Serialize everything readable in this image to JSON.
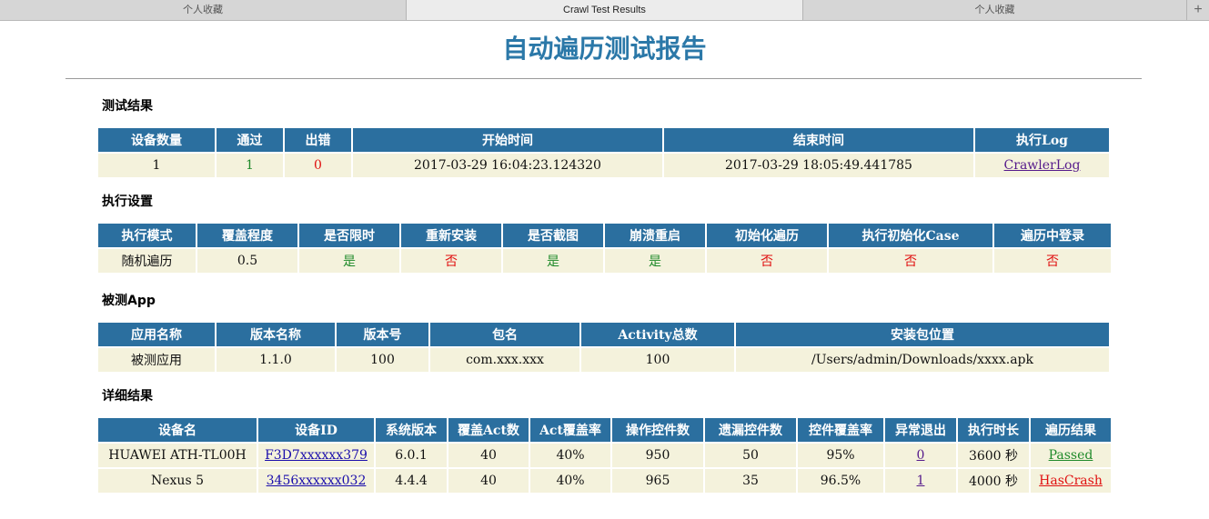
{
  "tabs": [
    "个人收藏",
    "Crawl Test Results",
    "个人收藏"
  ],
  "tab_plus": "+",
  "title": "自动遍历测试报告",
  "section1": {
    "label": "测试结果",
    "headers": [
      "设备数量",
      "通过",
      "出错",
      "开始时间",
      "结束时间",
      "执行Log"
    ],
    "row": {
      "count": "1",
      "pass": "1",
      "fail": "0",
      "start": "2017-03-29 16:04:23.124320",
      "end": "2017-03-29 18:05:49.441785",
      "log": "CrawlerLog"
    }
  },
  "section2": {
    "label": "执行设置",
    "headers": [
      "执行模式",
      "覆盖程度",
      "是否限时",
      "重新安装",
      "是否截图",
      "崩溃重启",
      "初始化遍历",
      "执行初始化Case",
      "遍历中登录"
    ],
    "row": {
      "mode": "随机遍历",
      "coverage": "0.5",
      "time_limit": "是",
      "reinstall": "否",
      "screenshot": "是",
      "crash_restart": "是",
      "init_crawl": "否",
      "init_case": "否",
      "login": "否"
    }
  },
  "section3": {
    "label": "被测App",
    "headers": [
      "应用名称",
      "版本名称",
      "版本号",
      "包名",
      "Activity总数",
      "安装包位置"
    ],
    "row": {
      "app_name": "被测应用",
      "version_name": "1.1.0",
      "version_code": "100",
      "package": "com.xxx.xxx",
      "activities": "100",
      "apk_path": "/Users/admin/Downloads/xxxx.apk"
    }
  },
  "section4": {
    "label": "详细结果",
    "headers": [
      "设备名",
      "设备ID",
      "系统版本",
      "覆盖Act数",
      "Act覆盖率",
      "操作控件数",
      "遗漏控件数",
      "控件覆盖率",
      "异常退出",
      "执行时长",
      "遍历结果"
    ],
    "rows": [
      {
        "device": "HUAWEI ATH-TL00H",
        "device_id": "F3D7xxxxxx379",
        "os": "6.0.1",
        "act_count": "40",
        "act_rate": "40%",
        "ops": "950",
        "missed": "50",
        "ctrl_rate": "95%",
        "crashes": "0",
        "duration": "3600 秒",
        "result": "Passed"
      },
      {
        "device": "Nexus 5",
        "device_id": "3456xxxxxx032",
        "os": "4.4.4",
        "act_count": "40",
        "act_rate": "40%",
        "ops": "965",
        "missed": "35",
        "ctrl_rate": "96.5%",
        "crashes": "1",
        "duration": "4000 秒",
        "result": "HasCrash"
      }
    ]
  },
  "colors": {
    "header_bg": "#2b6f9f",
    "cell_bg": "#f4f2dc",
    "title": "#2b78a8",
    "pass": "#1f8a2a",
    "fail": "#e01010"
  }
}
